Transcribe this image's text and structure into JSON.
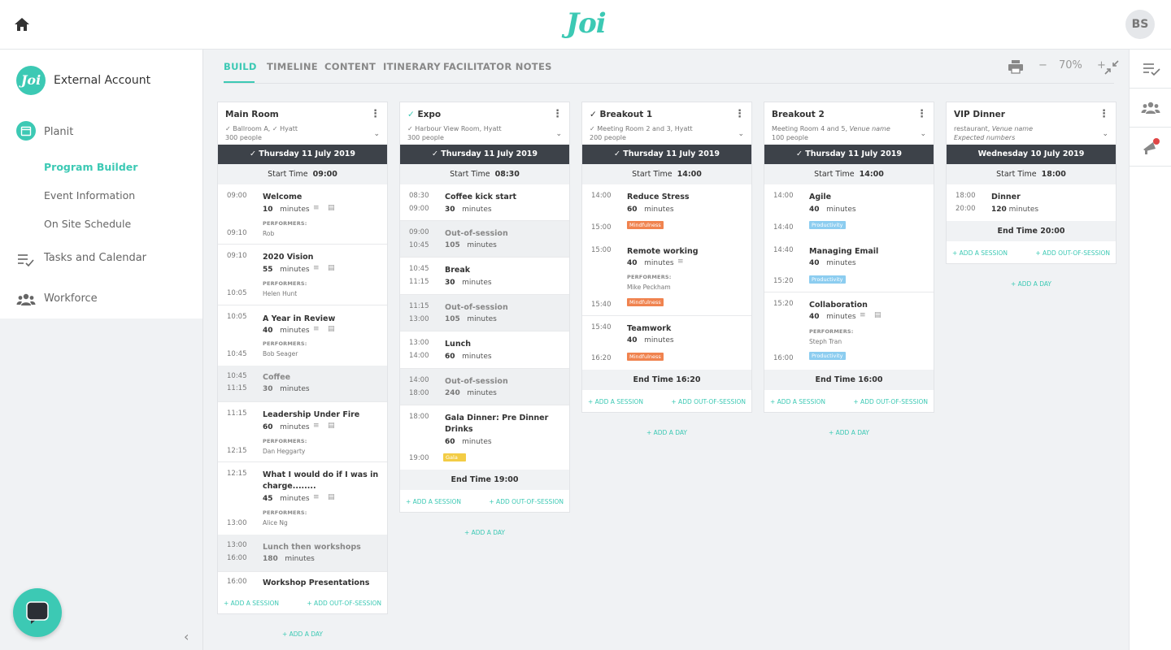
{
  "app": {
    "logo_text": "Joi",
    "avatar_initials": "BS",
    "account_name": "External Account",
    "account_logo": "Joi"
  },
  "sidebar": {
    "planit": "Planit",
    "program_builder": "Program Builder",
    "event_information": "Event Information",
    "on_site_schedule": "On Site Schedule",
    "tasks": "Tasks and Calendar",
    "workforce": "Workforce"
  },
  "tabs": [
    "BUILD",
    "TIMELINE",
    "CONTENT",
    "ITINERARY",
    "FACILITATOR NOTES"
  ],
  "toolbar": {
    "zoom": "70%",
    "minus": "−",
    "plus": "+"
  },
  "labels": {
    "start_time": "Start Time",
    "add_session": "+ ADD A SESSION",
    "add_oos": "+ ADD OUT-OF-SESSION",
    "add_day": "+ ADD A DAY",
    "performers": "PERFORMERS:",
    "minutes": "minutes"
  },
  "colors": {
    "accent": "#3cc9b4",
    "mindfulness": "#f0834f",
    "productivity": "#8ccdf0",
    "gala": "#f3cc45"
  },
  "columns": [
    {
      "title": "Main Room",
      "venue": "✓ Ballroom A, ✓ Hyatt",
      "people": "300 people",
      "date": "✓ Thursday 11 July 2019",
      "start": "09:00",
      "end": "",
      "sessions": [
        {
          "start": "09:00",
          "end": "09:10",
          "title": "Welcome",
          "dur": "10",
          "icons": true,
          "performers": "Rob",
          "tag": "",
          "oos": false
        },
        {
          "start": "09:10",
          "end": "10:05",
          "title": "2020 Vision",
          "dur": "55",
          "icons": true,
          "performers": "Helen Hunt",
          "tag": "",
          "oos": false
        },
        {
          "start": "10:05",
          "end": "10:45",
          "title": "A Year in Review",
          "dur": "40",
          "icons": true,
          "performers": "Bob Seager",
          "tag": "",
          "oos": false
        },
        {
          "start": "10:45",
          "end": "11:15",
          "title": "Coffee",
          "dur": "30",
          "icons": false,
          "performers": "",
          "tag": "",
          "oos": true
        },
        {
          "start": "11:15",
          "end": "12:15",
          "title": "Leadership Under Fire",
          "dur": "60",
          "icons": true,
          "performers": "Dan Heggarty",
          "tag": "",
          "oos": false
        },
        {
          "start": "12:15",
          "end": "13:00",
          "title": "What I would do if I was in",
          "title2": "charge........",
          "dur": "45",
          "icons": true,
          "performers": "Alice Ng",
          "tag": "",
          "oos": false
        },
        {
          "start": "13:00",
          "end": "16:00",
          "title": "Lunch then workshops",
          "dur": "180",
          "icons": false,
          "performers": "",
          "tag": "",
          "oos": true
        },
        {
          "start": "16:00",
          "end": "",
          "title": "Workshop Presentations",
          "dur": "",
          "icons": false,
          "performers": "",
          "tag": "",
          "oos": false
        }
      ]
    },
    {
      "title": "Expo",
      "venue": "✓ Harbour View Room, Hyatt",
      "people": "300 people",
      "date": "✓ Thursday 11 July 2019",
      "start": "08:30",
      "end": "End Time 19:00",
      "sessions": [
        {
          "start": "08:30",
          "end": "09:00",
          "title": "Coffee kick start",
          "dur": "30",
          "oos": false
        },
        {
          "start": "09:00",
          "end": "10:45",
          "title": "Out-of-session",
          "dur": "105",
          "oos": true
        },
        {
          "start": "10:45",
          "end": "11:15",
          "title": "Break",
          "dur": "30",
          "oos": false
        },
        {
          "start": "11:15",
          "end": "13:00",
          "title": "Out-of-session",
          "dur": "105",
          "oos": true
        },
        {
          "start": "13:00",
          "end": "14:00",
          "title": "Lunch",
          "dur": "60",
          "oos": false
        },
        {
          "start": "14:00",
          "end": "18:00",
          "title": "Out-of-session",
          "dur": "240",
          "oos": true
        },
        {
          "start": "18:00",
          "end": "19:00",
          "title": "Gala Dinner: Pre Dinner",
          "title2": "Drinks",
          "dur": "60",
          "tag": "Gala",
          "oos": false
        }
      ]
    },
    {
      "title": "✓ Breakout 1",
      "venue": "✓ Meeting Room 2 and 3, Hyatt",
      "people": "200 people",
      "date": "✓ Thursday 11 July 2019",
      "start": "14:00",
      "end": "End Time 16:20",
      "sessions": [
        {
          "start": "14:00",
          "end": "15:00",
          "title": "Reduce Stress",
          "dur": "60",
          "tag": "Mindfulness"
        },
        {
          "start": "15:00",
          "end": "15:40",
          "title": "Remote working",
          "dur": "40",
          "performers": "Mike Peckham",
          "tag": "Mindfulness"
        },
        {
          "start": "15:40",
          "end": "16:20",
          "title": "Teamwork",
          "dur": "40",
          "tag": "Mindfulness"
        }
      ]
    },
    {
      "title": "Breakout 2",
      "venue": "Meeting Room 4 and 5, ",
      "venue_em": "Venue name",
      "people": "100 people",
      "date": "✓ Thursday 11 July 2019",
      "start": "14:00",
      "end": "End Time 16:00",
      "sessions": [
        {
          "start": "14:00",
          "end": "14:40",
          "title": "Agile",
          "dur": "40",
          "tag": "Productivity"
        },
        {
          "start": "14:40",
          "end": "15:20",
          "title": "Managing Email",
          "dur": "40",
          "tag": "Productivity"
        },
        {
          "start": "15:20",
          "end": "16:00",
          "title": "Collaboration",
          "dur": "40",
          "performers": "Steph Tran",
          "tag": "Productivity"
        }
      ]
    },
    {
      "title": "VIP Dinner",
      "venue": "restaurant, ",
      "venue_em": "Venue name",
      "people_em": "Expected numbers",
      "date": "Wednesday 10 July 2019",
      "start": "18:00",
      "end": "End Time 20:00",
      "sessions": [
        {
          "start": "18:00",
          "end": "20:00",
          "title": "Dinner",
          "dur": "120"
        }
      ]
    }
  ]
}
